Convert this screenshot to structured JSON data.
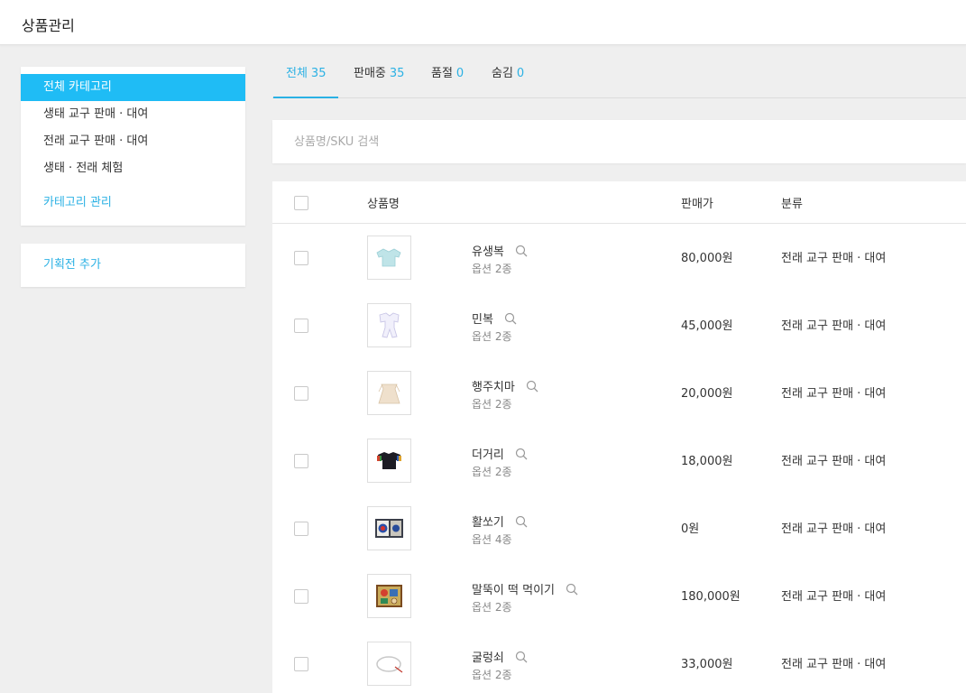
{
  "header": {
    "title": "상품관리"
  },
  "sidebar": {
    "categories": [
      {
        "label": "전체 카테고리",
        "active": true
      },
      {
        "label": "생태 교구 판매 · 대여",
        "active": false
      },
      {
        "label": "전래 교구 판매 · 대여",
        "active": false
      },
      {
        "label": "생태 · 전래 체험",
        "active": false
      }
    ],
    "manage_label": "카테고리 관리",
    "plan_add_label": "기획전 추가"
  },
  "tabs": [
    {
      "label": "전체",
      "count": "35",
      "active": true
    },
    {
      "label": "판매중",
      "count": "35",
      "active": false
    },
    {
      "label": "품절",
      "count": "0",
      "active": false
    },
    {
      "label": "숨김",
      "count": "0",
      "active": false
    }
  ],
  "search": {
    "placeholder": "상품명/SKU 검색",
    "value": ""
  },
  "table": {
    "headers": {
      "name": "상품명",
      "price": "판매가",
      "category": "분류"
    },
    "rows": [
      {
        "name": "유생복",
        "options": "옵션 2종",
        "price": "80,000원",
        "category": "전래 교구 판매 · 대여",
        "thumb_icon": "light-blue-garment-icon"
      },
      {
        "name": "민복",
        "options": "옵션 2종",
        "price": "45,000원",
        "category": "전래 교구 판매 · 대여",
        "thumb_icon": "white-outfit-icon"
      },
      {
        "name": "행주치마",
        "options": "옵션 2종",
        "price": "20,000원",
        "category": "전래 교구 판매 · 대여",
        "thumb_icon": "beige-apron-icon"
      },
      {
        "name": "더거리",
        "options": "옵션 2종",
        "price": "18,000원",
        "category": "전래 교구 판매 · 대여",
        "thumb_icon": "black-jacket-icon"
      },
      {
        "name": "활쏘기",
        "options": "옵션 4종",
        "price": "0원",
        "category": "전래 교구 판매 · 대여",
        "thumb_icon": "archery-target-icon"
      },
      {
        "name": "말뚝이 떡 먹이기",
        "options": "옵션 2종",
        "price": "180,000원",
        "category": "전래 교구 판매 · 대여",
        "thumb_icon": "game-board-icon"
      },
      {
        "name": "굴렁쇠",
        "options": "옵션 2종",
        "price": "33,000원",
        "category": "전래 교구 판매 · 대여",
        "thumb_icon": "hoop-ring-icon"
      }
    ]
  },
  "colors": {
    "accent": "#1fbcf5",
    "link": "#2bb1e4",
    "background": "#efefef"
  }
}
